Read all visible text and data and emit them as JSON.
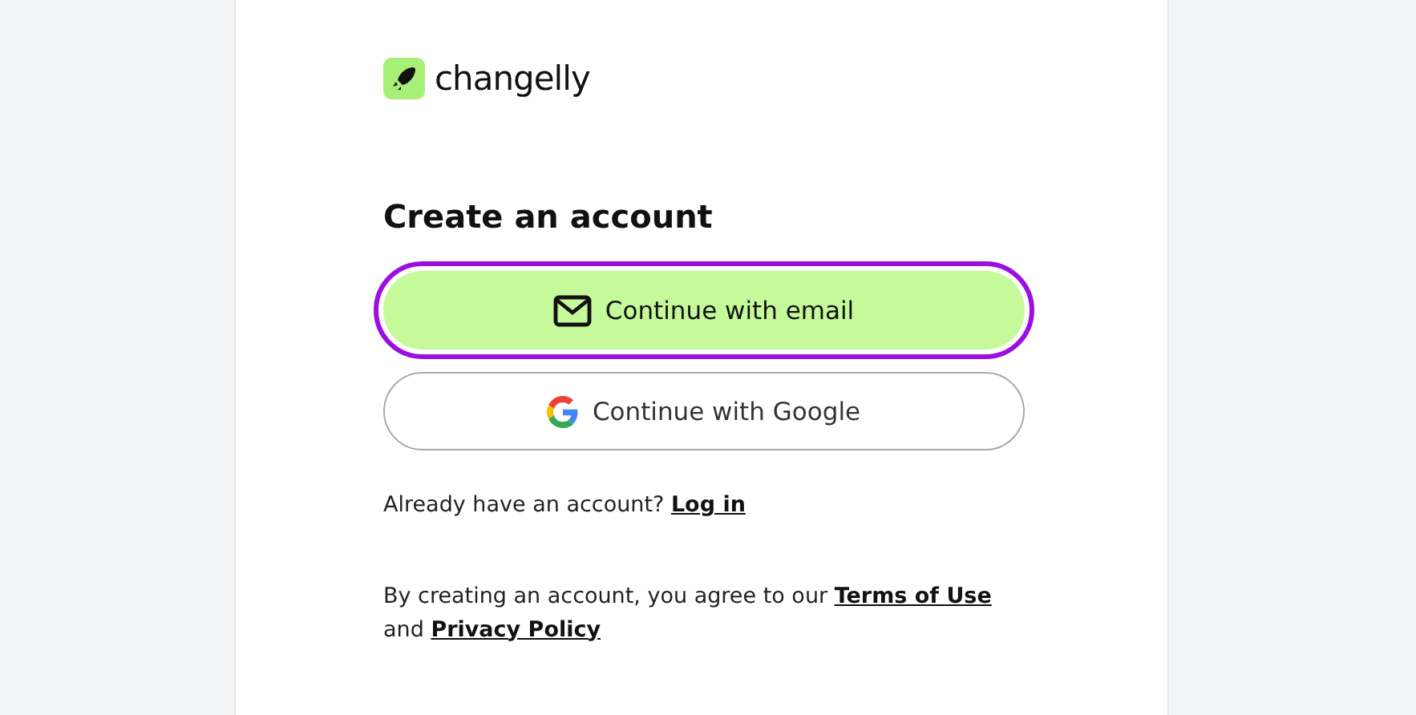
{
  "logo": {
    "name": "changelly"
  },
  "heading": "Create an account",
  "buttons": [
    {
      "kind": "email",
      "label": "Continue with email",
      "highlighted": true
    },
    {
      "kind": "google",
      "label": "Continue with Google",
      "highlighted": false
    }
  ],
  "login_prompt": {
    "text": "Already have an account?",
    "link": "Log in"
  },
  "terms": [
    {
      "kind": "text",
      "text": "By creating an account, you agree to our"
    },
    {
      "kind": "link",
      "text": "Terms of Use"
    },
    {
      "kind": "text",
      "text": "and"
    },
    {
      "kind": "link",
      "text": "Privacy Policy"
    }
  ]
}
